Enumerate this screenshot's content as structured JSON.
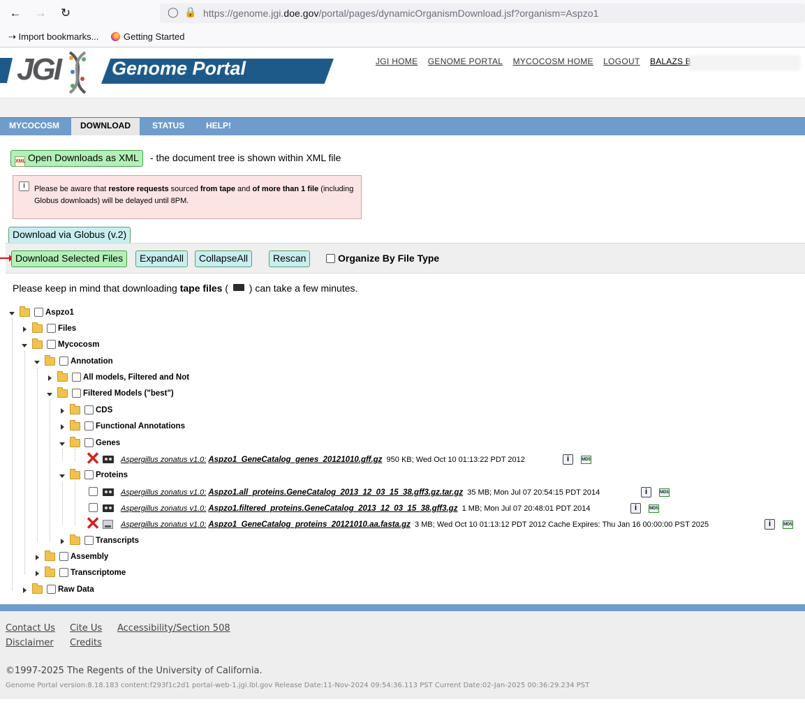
{
  "browser": {
    "url_prefix": "https://genome.jgi.",
    "url_domain": "doe.gov",
    "url_suffix": "/portal/pages/dynamicOrganismDownload.jsf?organism=Aspzo1",
    "bookmarks": [
      "Import bookmarks...",
      "Getting Started"
    ]
  },
  "header": {
    "logo_text": "JGI",
    "portal_title": "Genome Portal",
    "nav": [
      "JGI HOME",
      "GENOME PORTAL",
      "MYCOCOSM HOME",
      "LOGOUT"
    ],
    "username": "BALAZS BALINT"
  },
  "tabs": [
    {
      "label": "MYCOCOSM",
      "active": false
    },
    {
      "label": "DOWNLOAD",
      "active": true
    },
    {
      "label": "STATUS",
      "active": false
    },
    {
      "label": "HELP!",
      "active": false
    }
  ],
  "content": {
    "xml_button": "Open Downloads as XML",
    "xml_note": "- the document tree is shown within XML file",
    "alert": {
      "p1": "Please be aware that ",
      "b1": "restore requests",
      "p2": " sourced ",
      "b2": "from tape",
      "p3": " and ",
      "b3": "of more than 1 file",
      "p4": " (including Globus downloads) will be delayed until 8PM."
    },
    "globus_button": "Download via Globus (v.2)",
    "toolbar": {
      "download": "Download Selected Files",
      "expand": "ExpandAll",
      "collapse": "CollapseAll",
      "rescan": "Rescan",
      "organize": "Organize By File Type"
    },
    "tape_note_a": "Please keep in mind that downloading ",
    "tape_note_b": "tape files",
    "tape_note_c": " (",
    "tape_note_d": ") can take a few minutes."
  },
  "tree": {
    "root": "Aspzo1",
    "files": "Files",
    "mycocosm": "Mycocosm",
    "annotation": "Annotation",
    "all_models": "All models, Filtered and Not",
    "filtered_models": "Filtered Models (\"best\")",
    "cds": "CDS",
    "functional": "Functional Annotations",
    "genes": "Genes",
    "proteins": "Proteins",
    "transcripts": "Transcripts",
    "assembly": "Assembly",
    "transcriptome": "Transcriptome",
    "raw_data": "Raw Data",
    "organism": "Aspergillus zonatus v1.0:",
    "files_list": [
      {
        "name": "Aspzo1_GeneCatalog_genes_20121010.gff.gz",
        "meta": "950 KB;  Wed Oct 10 01:13:22 PDT 2012"
      },
      {
        "name": "Aspzo1.all_proteins.GeneCatalog_2013_12_03_15_38.gff3.gz.tar.gz",
        "meta": "35 MB;  Mon Jul 07 20:54:15 PDT 2014"
      },
      {
        "name": "Aspzo1.filtered_proteins.GeneCatalog_2013_12_03_15_38.gff3.gz",
        "meta": "1 MB;  Mon Jul 07 20:48:01 PDT 2014"
      },
      {
        "name": "Aspzo1_GeneCatalog_proteins_20121010.aa.fasta.gz",
        "meta": "3 MB;  Wed Oct 10 01:13:12 PDT 2012  Cache Expires: Thu Jan 16 00:00:00 PST 2025"
      }
    ],
    "info_glyph": "i",
    "md5_label": "MD5"
  },
  "footer": {
    "links": [
      "Contact Us",
      "Cite Us",
      "Accessibility/Section 508",
      "Disclaimer",
      "Credits"
    ],
    "copyright": "©1997-2025 The Regents of the University of California.",
    "version": "Genome Portal version:8.18.183 content:f293f1c2d1 portal-web-1.jgi.lbl.gov Release Date:11-Nov-2024 09:54:36.113 PST Current Date:02-Jan-2025 00:36:29.234 PST"
  }
}
